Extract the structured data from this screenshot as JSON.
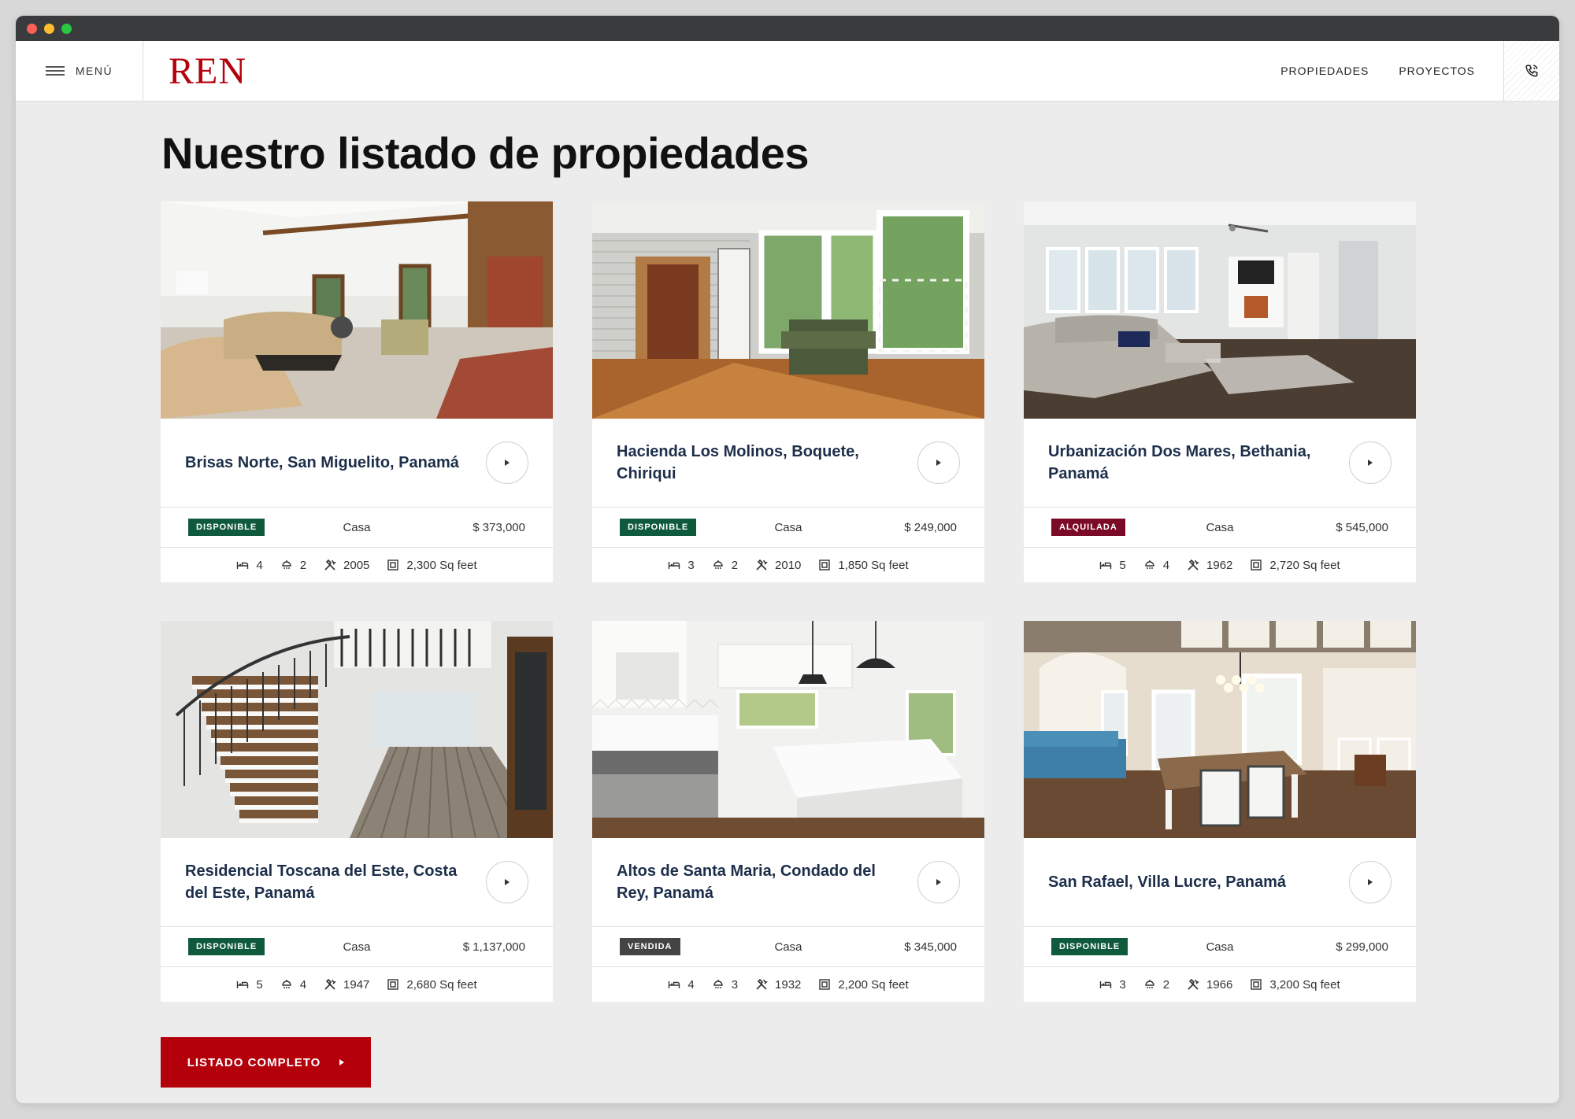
{
  "brand": {
    "logo": "REN"
  },
  "nav": {
    "menu_label": "MENÚ",
    "links": [
      "PROPIEDADES",
      "PROYECTOS"
    ]
  },
  "page": {
    "title": "Nuestro listado de propiedades"
  },
  "status_colors": {
    "DISPONIBLE": "#0f5a3c",
    "ALQUILADA": "#7a0a26",
    "VENDIDA": "#444444"
  },
  "listings": [
    {
      "title": "Brisas Norte, San Miguelito, Panamá",
      "status": "DISPONIBLE",
      "type": "Casa",
      "price": "$ 373,000",
      "beds": "4",
      "baths": "2",
      "year": "2005",
      "area": "2,300 Sq feet",
      "photo": "living-room"
    },
    {
      "title": "Hacienda Los Molinos, Boquete, Chiriqui",
      "status": "DISPONIBLE",
      "type": "Casa",
      "price": "$ 249,000",
      "beds": "3",
      "baths": "2",
      "year": "2010",
      "area": "1,850 Sq feet",
      "photo": "sunroom"
    },
    {
      "title": "Urbanización Dos Mares, Bethania, Panamá",
      "status": "ALQUILADA",
      "type": "Casa",
      "price": "$ 545,000",
      "beds": "5",
      "baths": "4",
      "year": "1962",
      "area": "2,720 Sq feet",
      "photo": "family-room"
    },
    {
      "title": "Residencial Toscana del Este, Costa del Este, Panamá",
      "status": "DISPONIBLE",
      "type": "Casa",
      "price": "$ 1,137,000",
      "beds": "5",
      "baths": "4",
      "year": "1947",
      "area": "2,680 Sq feet",
      "photo": "staircase"
    },
    {
      "title": "Altos de Santa Maria, Condado del Rey, Panamá",
      "status": "VENDIDA",
      "type": "Casa",
      "price": "$ 345,000",
      "beds": "4",
      "baths": "3",
      "year": "1932",
      "area": "2,200 Sq feet",
      "photo": "kitchen"
    },
    {
      "title": "San Rafael, Villa Lucre, Panamá",
      "status": "DISPONIBLE",
      "type": "Casa",
      "price": "$ 299,000",
      "beds": "3",
      "baths": "2",
      "year": "1966",
      "area": "3,200 Sq feet",
      "photo": "dining-room"
    }
  ],
  "cta": {
    "label": "LISTADO COMPLETO"
  }
}
